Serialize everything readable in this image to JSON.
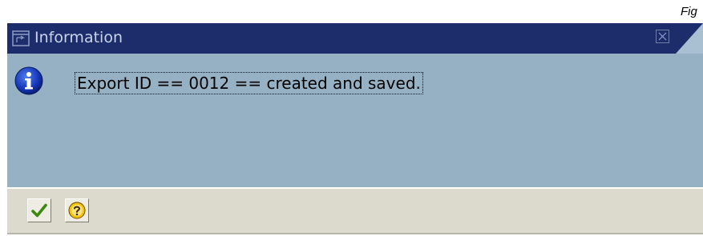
{
  "figure": {
    "label": "Fig"
  },
  "dialog": {
    "title": "Information",
    "title_icon": "window-icon",
    "close_icon": "close-icon",
    "message_icon": "info-icon",
    "message": "Export ID == 0012 == created and saved.",
    "buttons": [
      {
        "name": "ok-button",
        "icon": "checkmark-icon"
      },
      {
        "name": "help-button",
        "icon": "help-icon"
      }
    ]
  },
  "colors": {
    "title_bar": "#1d2d6b",
    "content_bg": "#96b1c3",
    "footer_bg": "#dcdacd",
    "checkmark": "#3a8a12",
    "help": "#f0b400"
  }
}
